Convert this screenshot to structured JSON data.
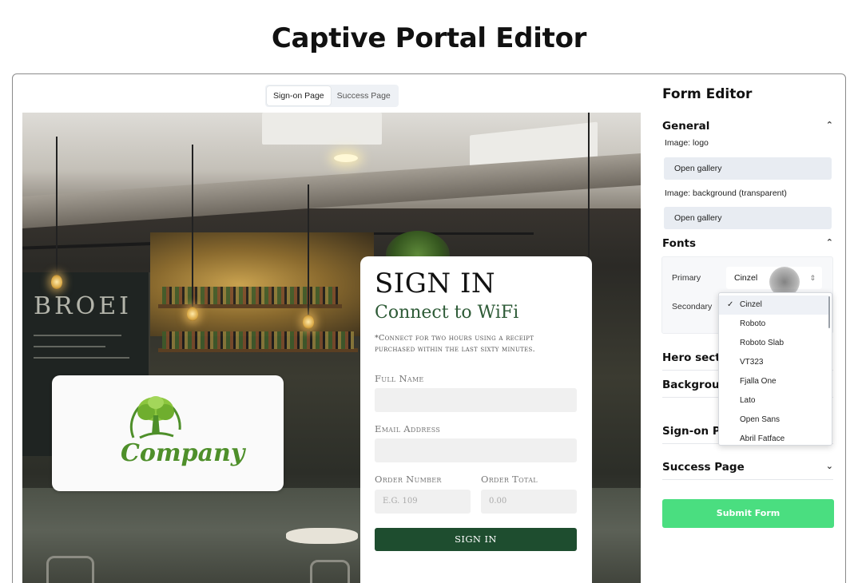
{
  "page": {
    "title": "Captive Portal Editor"
  },
  "tabs": [
    {
      "label": "Sign-on Page",
      "active": true
    },
    {
      "label": "Success Page",
      "active": false
    }
  ],
  "preview": {
    "background_sign": "BROEI",
    "logo": {
      "wordmark": "Company",
      "color": "#4e8f2a"
    },
    "signin": {
      "title": "SIGN IN",
      "subtitle": "Connect to WiFi",
      "note": "*Connect for two hours using a receipt purchased within the last sixty minutes.",
      "fields": {
        "full_name_label": "Full Name",
        "email_label": "Email Address",
        "order_number_label": "Order Number",
        "order_number_placeholder": "E.G. 109",
        "order_total_label": "Order Total",
        "order_total_placeholder": "0.00"
      },
      "button_label": "SIGN IN",
      "button_color": "#1e4d2f"
    }
  },
  "editor": {
    "title": "Form Editor",
    "sections": {
      "general": "General",
      "fonts": "Fonts",
      "hero": "Hero sectio",
      "background": "Backgroun",
      "signon": "Sign-on P",
      "success": "Success Page"
    },
    "general": {
      "logo_label": "Image: logo",
      "logo_button": "Open gallery",
      "bg_label": "Image: background (transparent)",
      "bg_button": "Open gallery"
    },
    "fonts": {
      "primary_label": "Primary",
      "primary_value": "Cinzel",
      "secondary_label": "Secondary",
      "options": [
        "Cinzel",
        "Roboto",
        "Roboto Slab",
        "VT323",
        "Fjalla One",
        "Lato",
        "Open Sans",
        "Abril Fatface"
      ],
      "selected_option": "Cinzel"
    },
    "submit_label": "Submit Form",
    "submit_color": "#4ade80"
  }
}
